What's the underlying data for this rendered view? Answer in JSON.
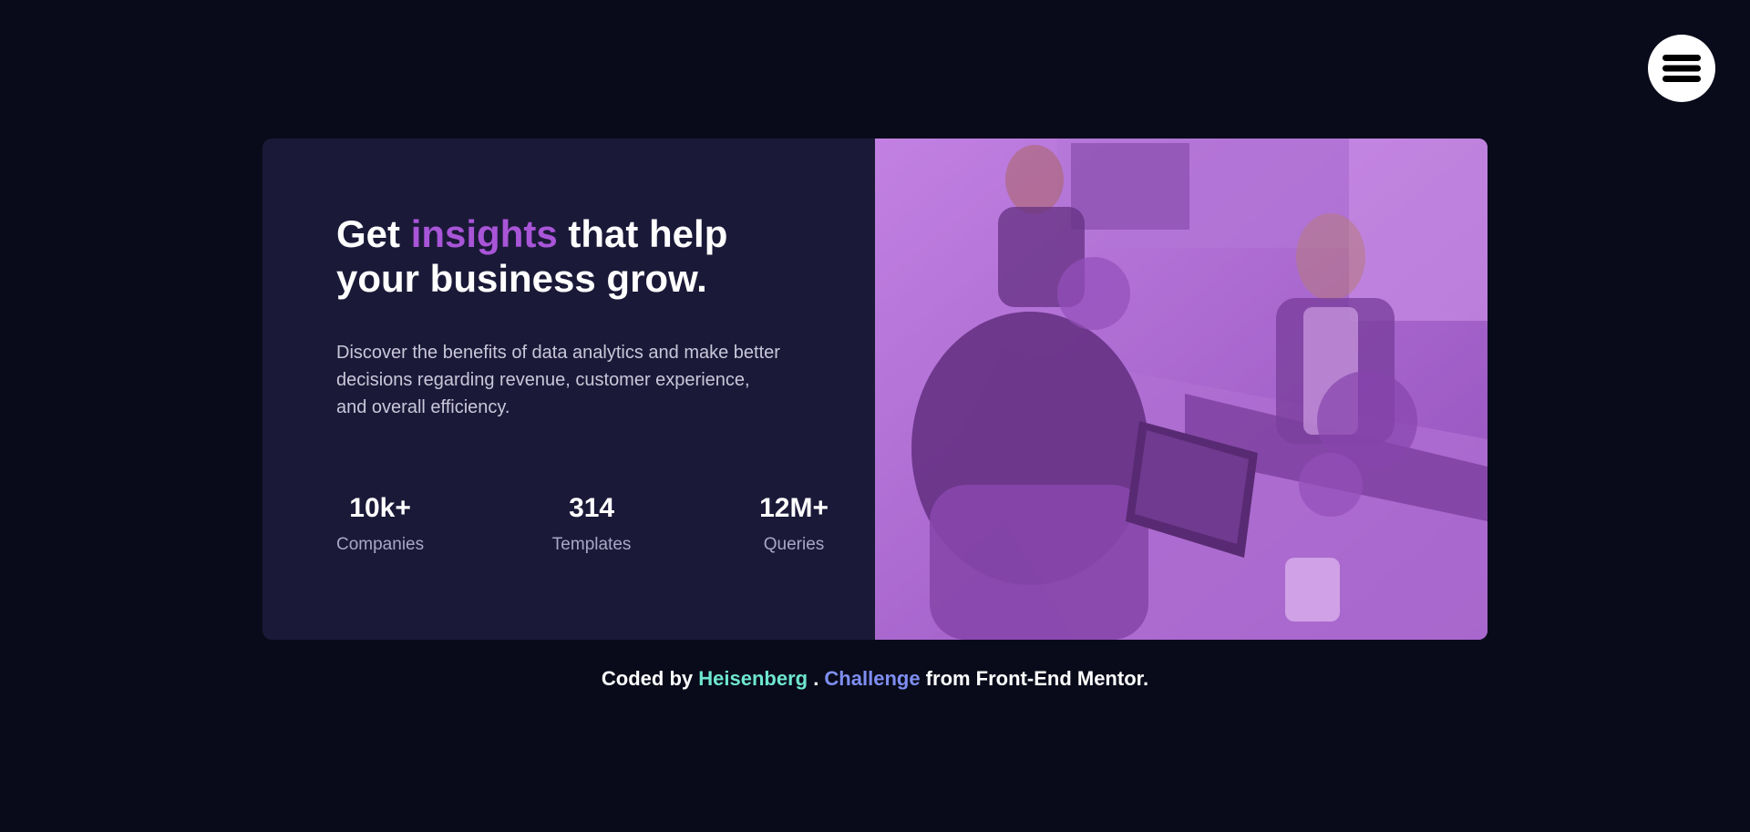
{
  "header": {
    "menu_icon": "hamburger-menu-icon"
  },
  "hero": {
    "title_part1": "Get ",
    "title_highlight": "insights",
    "title_part2": " that help your business grow.",
    "description": "Discover the benefits of data analytics and make better decisions regarding revenue, customer experience, and overall efficiency.",
    "stats": [
      {
        "value": "10k+",
        "label": "Companies"
      },
      {
        "value": "314",
        "label": "Templates"
      },
      {
        "value": "12M+",
        "label": "Queries"
      }
    ]
  },
  "footer": {
    "prefix": "Coded by ",
    "author": "Heisenberg",
    "separator": " . ",
    "challenge": "Challenge",
    "suffix": " from Front-End Mentor."
  },
  "colors": {
    "background": "#090b1a",
    "card": "#1b1938",
    "accent": "#a855d8",
    "image_overlay": "#9d5bc4",
    "author_link": "#6ee7d0",
    "challenge_link": "#7e8ef1"
  }
}
